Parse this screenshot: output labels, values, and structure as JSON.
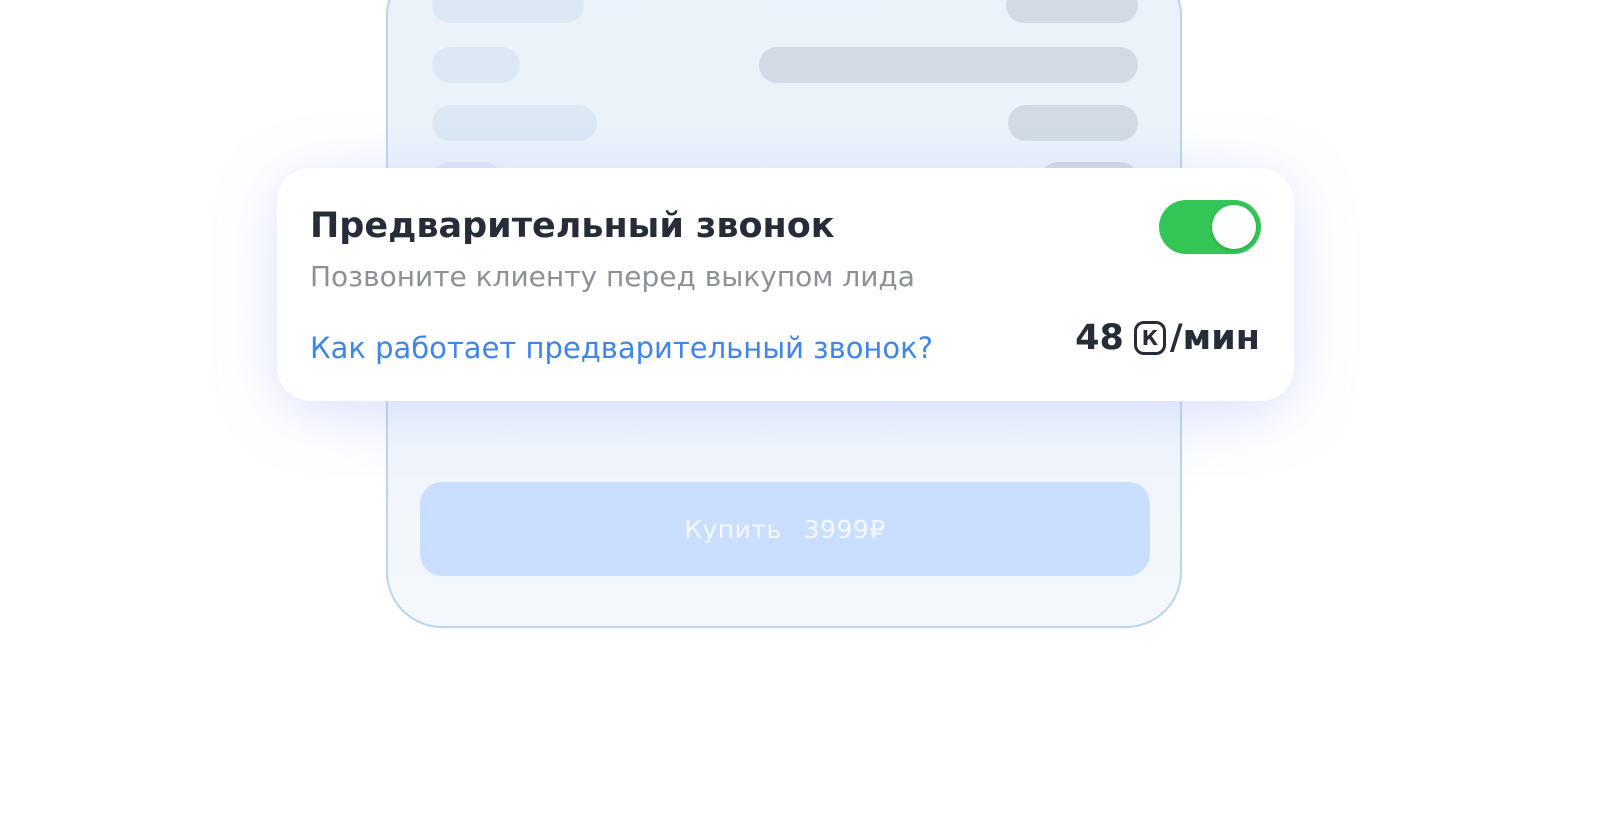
{
  "card": {
    "title": "Предварительный звонок",
    "subtitle": "Позвоните клиенту перед выкупом лида",
    "link_text": "Как работает предварительный звонок?",
    "toggle": {
      "state": "on",
      "color": "#33c555"
    },
    "rate": {
      "amount": "48",
      "currency_symbol": "К",
      "unit": "/мин"
    }
  },
  "buy_button": {
    "label": "Купить",
    "price": "3999₽"
  },
  "colors": {
    "link": "#3f85ea",
    "title": "#262c38",
    "subtitle": "#8a9199",
    "button_bg": "#cadeff",
    "phone_border": "#b9d6ec"
  }
}
